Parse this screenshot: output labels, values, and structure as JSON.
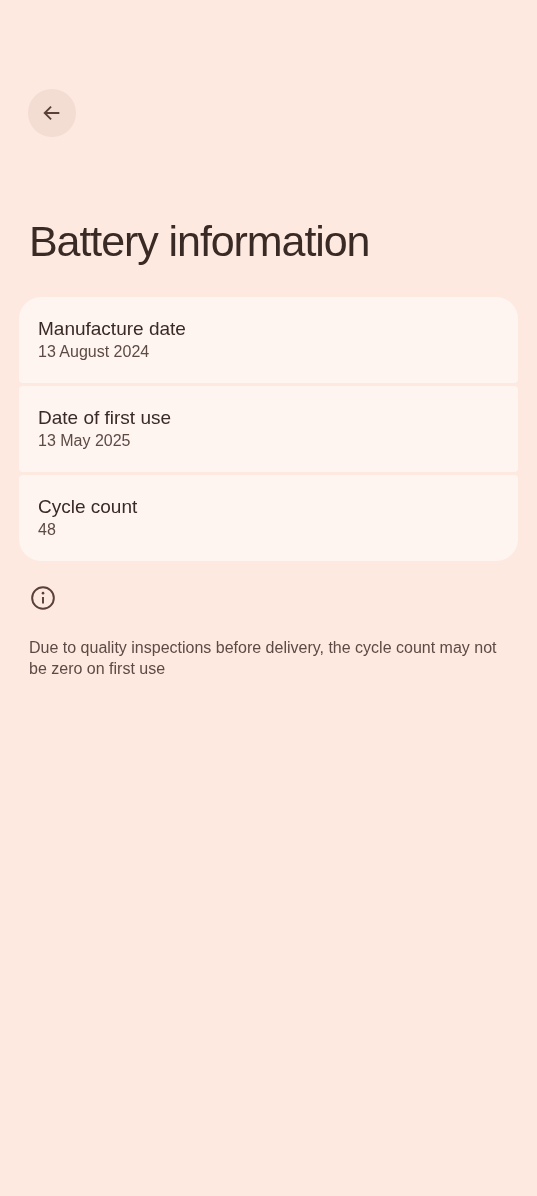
{
  "title": "Battery information",
  "items": [
    {
      "label": "Manufacture date",
      "value": "13 August 2024"
    },
    {
      "label": "Date of first use",
      "value": "13 May 2025"
    },
    {
      "label": "Cycle count",
      "value": "48"
    }
  ],
  "note": "Due to quality inspections before delivery, the cycle count may not be zero on first use"
}
